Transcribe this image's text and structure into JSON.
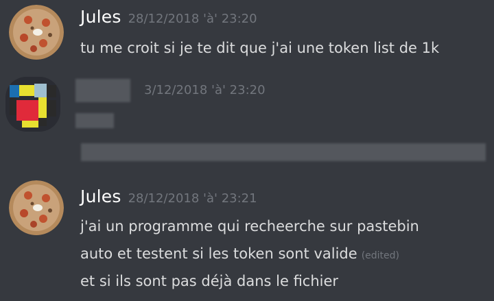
{
  "messages": [
    {
      "author": "Jules",
      "timestamp": "28/12/2018 'à' 23:20",
      "lines": [
        "tu me croit si je te dit que j'ai une token list de 1k"
      ]
    },
    {
      "author": "",
      "timestamp": "3/12/2018 'à' 23:20",
      "lines": []
    },
    {
      "author": "Jules",
      "timestamp": "28/12/2018 'à' 23:21",
      "lines": [
        "j'ai un programme qui recheerche sur pastebin",
        "auto et testent si les token sont valide",
        "et si ils sont pas déjà dans le fichier"
      ],
      "edited_label": "(edited)"
    }
  ],
  "colors": {
    "background": "#36393f",
    "username": "#ffffff",
    "text": "#dcddde",
    "muted": "#72767d"
  },
  "icons": {
    "avatar_jules": "pizza-avatar-icon",
    "avatar_censored": "pixelated-avatar-icon"
  }
}
